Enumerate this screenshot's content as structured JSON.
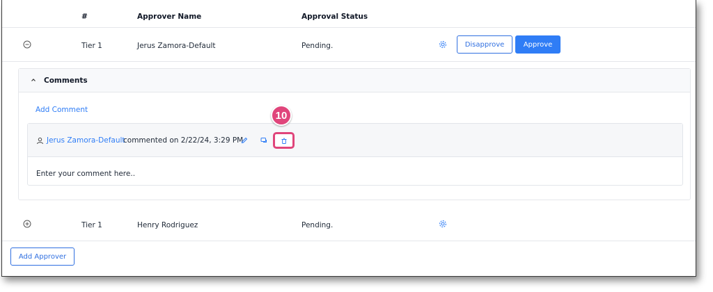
{
  "table": {
    "headers": {
      "num": "#",
      "approver_name": "Approver Name",
      "approval_status": "Approval Status"
    },
    "rows": [
      {
        "tier": "Tier 1",
        "approver": "Jerus Zamora-Default",
        "status": "Pending.",
        "toggle_icon": "collapse-minus-icon"
      },
      {
        "tier": "Tier 1",
        "approver": "Henry Rodriguez",
        "status": "Pending.",
        "toggle_icon": "expand-plus-icon"
      }
    ],
    "actions": {
      "disapprove": "Disapprove",
      "approve": "Approve"
    }
  },
  "comments": {
    "title": "Comments",
    "add_comment": "Add Comment",
    "entry": {
      "author": "Jerus Zamora-Default",
      "meta": "commented on  2/22/24, 3:29 PM",
      "placeholder_text": "Enter your comment here.."
    }
  },
  "step_badge": "10",
  "footer": {
    "add_approver": "Add Approver"
  },
  "colors": {
    "accent": "#2f7df6",
    "highlight": "#e0457b",
    "border": "#e5e7eb"
  }
}
